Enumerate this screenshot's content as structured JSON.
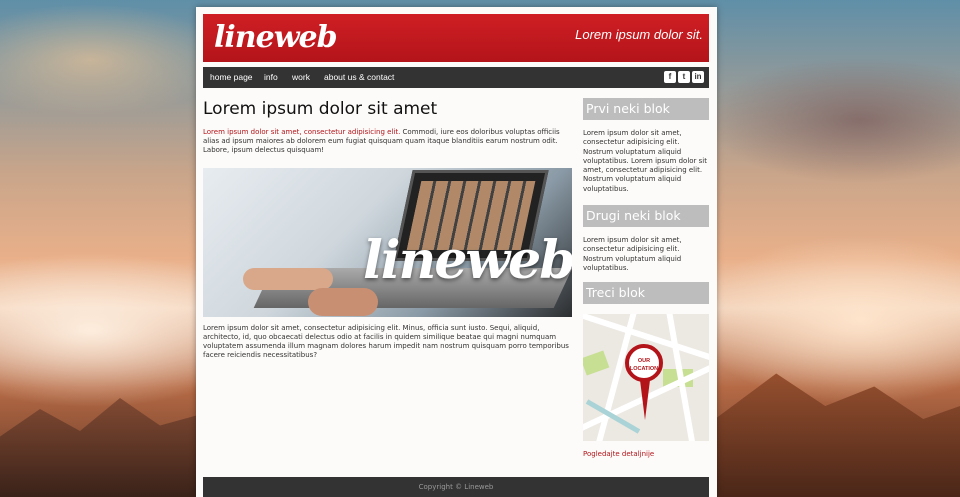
{
  "header": {
    "logo": "lineweb",
    "tagline": "Lorem ipsum dolor sit."
  },
  "nav": {
    "items": [
      "home page",
      "info",
      "work",
      "about us & contact"
    ],
    "social_icons": [
      "facebook-icon",
      "twitter-icon",
      "linkedin-icon"
    ],
    "social_glyphs": [
      "f",
      "t",
      "in"
    ]
  },
  "main": {
    "title": "Lorem ipsum dolor sit amet",
    "intro_link": "Lorem ipsum dolor sit amet, consectetur adipisicing elit.",
    "intro_rest": " Commodi, iure eos doloribus voluptas officiis alias ad ipsum maiores ab dolorem eum fugiat quisquam quam itaque blanditiis earum nostrum odit. Labore, ipsum delectus quisquam!",
    "image_watermark": "lineweb",
    "body": "Lorem ipsum dolor sit amet, consectetur adipisicing elit. Minus, officia sunt iusto. Sequi, aliquid, architecto, id, quo obcaecati delectus odio at facilis in quidem similique beatae qui magni numquam voluptatem assumenda illum magnam dolores harum impedit nam nostrum quisquam porro temporibus facere reiciendis necessitatibus?"
  },
  "sidebar": {
    "block1": {
      "title": "Prvi neki blok",
      "text": "Lorem ipsum dolor sit amet, consectetur adipisicing elit. Nostrum voluptatum aliquid voluptatibus. Lorem ipsum dolor sit amet, consectetur adipisicing elit. Nostrum voluptatum aliquid voluptatibus."
    },
    "block2": {
      "title": "Drugi neki blok",
      "text": "Lorem ipsum dolor sit amet, consectetur adipisicing elit. Nostrum voluptatum aliquid voluptatibus."
    },
    "block3": {
      "title": "Treci blok",
      "map_label_line1": "OUR",
      "map_label_line2": "LOCATION",
      "link": "Pogledajte detaljnije"
    }
  },
  "footer": {
    "copyright": "Copyright © Lineweb"
  },
  "colors": {
    "brand_red": "#b3141a",
    "nav_dark": "#333333",
    "sidebar_head": "#bdbdbd"
  }
}
